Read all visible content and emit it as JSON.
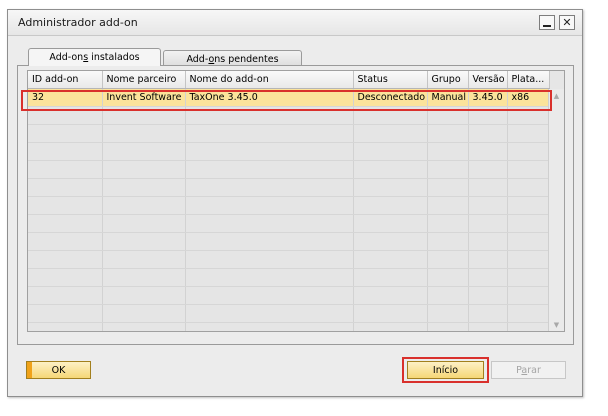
{
  "window": {
    "title": "Administrador add-on"
  },
  "tabs": [
    {
      "prefix": "Add-on",
      "underlined": "s",
      "suffix": " instalados",
      "active": true
    },
    {
      "prefix": "Add-",
      "underlined": "o",
      "suffix": "ns pendentes",
      "active": false
    }
  ],
  "grid": {
    "columns": [
      "ID add-on",
      "Nome parceiro",
      "Nome do add-on",
      "Status",
      "Grupo",
      "Versão",
      "Plata..."
    ],
    "rows": [
      [
        "32",
        "Invent Software",
        "TaxOne 3.45.0",
        "Desconectado",
        "Manual",
        "3.45.0",
        "x86"
      ]
    ],
    "empty_row_count": 13
  },
  "buttons": {
    "ok": "OK",
    "inicio": "Início",
    "parar_prefix": "P",
    "parar_underlined": "a",
    "parar_suffix": "rar"
  },
  "icons": {
    "minimize": "minimize-icon",
    "close": "close-icon",
    "scroll_up": "scroll-up-arrow-icon",
    "scroll_down": "scroll-down-arrow-icon"
  },
  "colors": {
    "selected_row": "#fbe39b",
    "highlight_outline": "#d9302c",
    "primary_button": "#f6d777"
  }
}
